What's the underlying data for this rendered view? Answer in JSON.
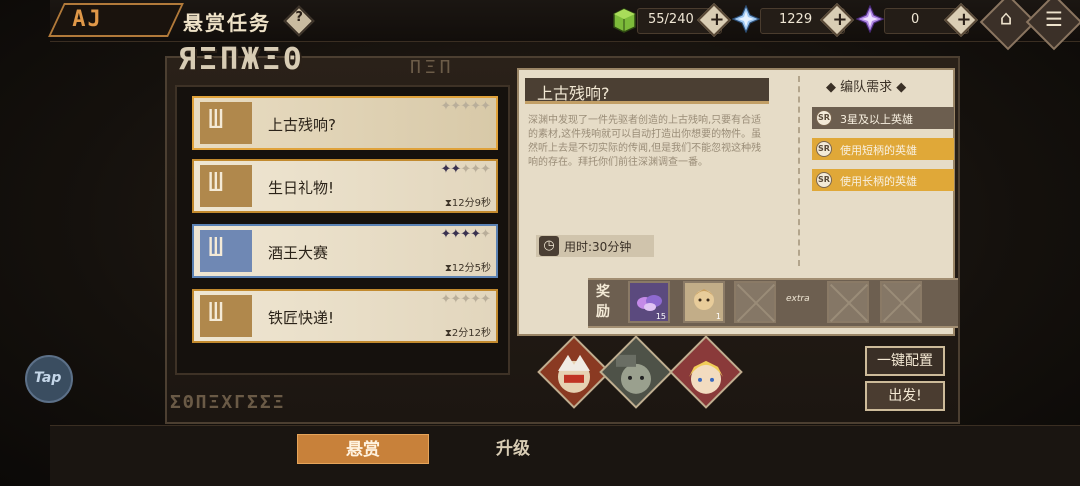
{
  "header": {
    "logo_text": "AJ",
    "title": "悬赏任务",
    "help_label": "?",
    "resources": [
      {
        "icon": "green-cube-icon",
        "value": "55/240",
        "add_label": "+"
      },
      {
        "icon": "blue-crystal-icon",
        "value": "1229",
        "add_label": "+"
      },
      {
        "icon": "purple-crystal-icon",
        "value": "0",
        "add_label": "+"
      }
    ],
    "home_icon": "home-icon",
    "menu_icon": "menu-icon"
  },
  "quest_list": {
    "items": [
      {
        "name": "上古残响?",
        "stars_on": 0,
        "stars_total": 5,
        "timer": "",
        "selected": true
      },
      {
        "name": "生日礼物!",
        "stars_on": 2,
        "stars_total": 5,
        "timer": "12分9秒",
        "selected": false
      },
      {
        "name": "酒王大赛",
        "stars_on": 4,
        "stars_total": 5,
        "timer": "12分5秒",
        "selected": false
      },
      {
        "name": "铁匠快递!",
        "stars_on": 0,
        "stars_total": 5,
        "timer": "2分12秒",
        "selected": false
      }
    ]
  },
  "detail": {
    "title": "上古残响?",
    "description": "深渊中发现了一件先驱者创造的上古残响,只要有合适的素材,这件残响就可以自动打造出你想要的物件。虽然听上去是不切实际的传闻,但是我们不能忽视这种残响的存在。拜托你们前往深渊调查一番。",
    "requirements_title": "编队需求",
    "requirements": [
      {
        "icon": "SR",
        "text": "3星及以上英雄",
        "style": "grey"
      },
      {
        "icon": "SR",
        "text": "使用短柄的英雄",
        "style": "gold"
      },
      {
        "icon": "SR",
        "text": "使用长柄的英雄",
        "style": "gold"
      }
    ],
    "duration": "用时:30分钟",
    "rewards_label": "奖励",
    "rewards": [
      {
        "icon": "purple-gem-icon",
        "count": "15"
      },
      {
        "icon": "hero-card-icon",
        "count": "1"
      }
    ],
    "extra_label": "extra"
  },
  "buttons": {
    "auto_assign": "一键配置",
    "depart": "出发!"
  },
  "tap_label": "Tap",
  "tabs": [
    {
      "label": "悬赏",
      "active": true
    },
    {
      "label": "升级",
      "active": false
    }
  ]
}
